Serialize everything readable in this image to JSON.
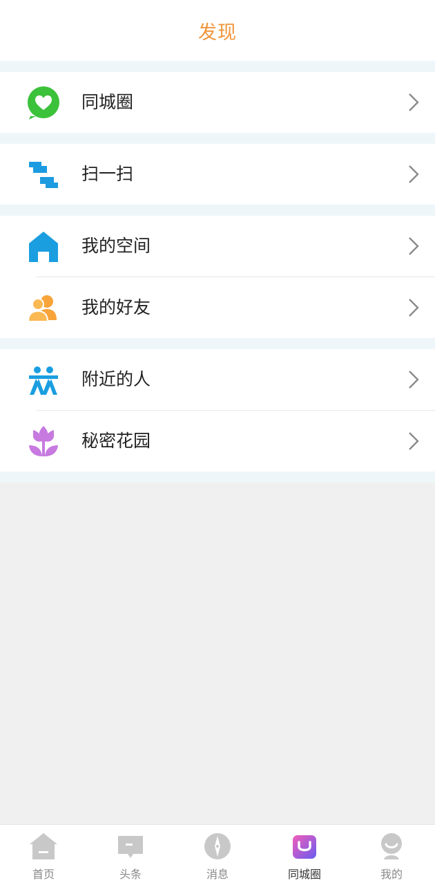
{
  "header": {
    "title": "发现"
  },
  "groups": [
    [
      {
        "label": "同城圈",
        "icon": "heart-bubble-icon",
        "color": "#3cc13b"
      }
    ],
    [
      {
        "label": "扫一扫",
        "icon": "scan-icon",
        "color": "#1c9be0"
      }
    ],
    [
      {
        "label": "我的空间",
        "icon": "home-icon",
        "color": "#1a9ee0"
      },
      {
        "label": "我的好友",
        "icon": "friends-icon",
        "color": "#f8a43a"
      }
    ],
    [
      {
        "label": "附近的人",
        "icon": "people-icon",
        "color": "#1a9ee0"
      },
      {
        "label": "秘密花园",
        "icon": "flower-icon",
        "color": "#c77ae0"
      }
    ]
  ],
  "tabbar": {
    "items": [
      {
        "label": "首页",
        "icon": "home-tab-icon"
      },
      {
        "label": "头条",
        "icon": "news-tab-icon"
      },
      {
        "label": "消息",
        "icon": "compass-tab-icon"
      },
      {
        "label": "同城圈",
        "icon": "shopping-bag-tab-icon",
        "active": true
      },
      {
        "label": "我的",
        "icon": "profile-tab-icon"
      }
    ]
  },
  "colors": {
    "accent": "#f0953a",
    "gap": "#eef6f9",
    "background": "#f0f0f0"
  }
}
